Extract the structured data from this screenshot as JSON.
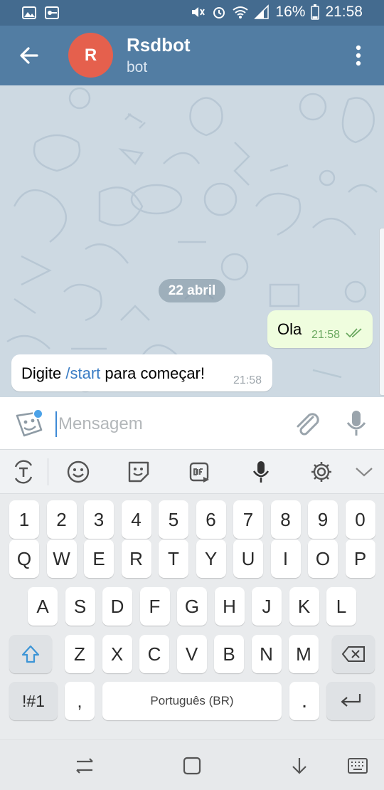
{
  "status_bar": {
    "battery": "16%",
    "time": "21:58"
  },
  "header": {
    "avatar_letter": "R",
    "title": "Rsdbot",
    "subtitle": "bot"
  },
  "chat": {
    "date_divider": "22 abril",
    "messages": [
      {
        "direction": "outgoing",
        "text": "Ola",
        "time": "21:58",
        "status": "read"
      },
      {
        "direction": "incoming",
        "text_before": "Digite ",
        "command": "/start",
        "text_after": " para começar!",
        "time": "21:58"
      }
    ]
  },
  "composer": {
    "placeholder": "Mensagem"
  },
  "keyboard": {
    "toolbar": [
      "text-mode-icon",
      "emoji-icon",
      "sticker-icon",
      "gif-icon",
      "voice-input-icon",
      "settings-icon",
      "collapse-icon"
    ],
    "number_row": [
      "1",
      "2",
      "3",
      "4",
      "5",
      "6",
      "7",
      "8",
      "9",
      "0"
    ],
    "row1": [
      "Q",
      "W",
      "E",
      "R",
      "T",
      "Y",
      "U",
      "I",
      "O",
      "P"
    ],
    "row2": [
      "A",
      "S",
      "D",
      "F",
      "G",
      "H",
      "J",
      "K",
      "L"
    ],
    "row3": [
      "Z",
      "X",
      "C",
      "V",
      "B",
      "N",
      "M"
    ],
    "symbols_key": "!#1",
    "comma_key": ",",
    "space_label": "Português (BR)",
    "period_key": "."
  },
  "colors": {
    "header": "#527da3",
    "status_bar": "#446b8f",
    "avatar": "#e5604d",
    "outgoing_bubble": "#effdde",
    "command_link": "#3a7cc4",
    "chat_bg": "#cdd9e2"
  }
}
